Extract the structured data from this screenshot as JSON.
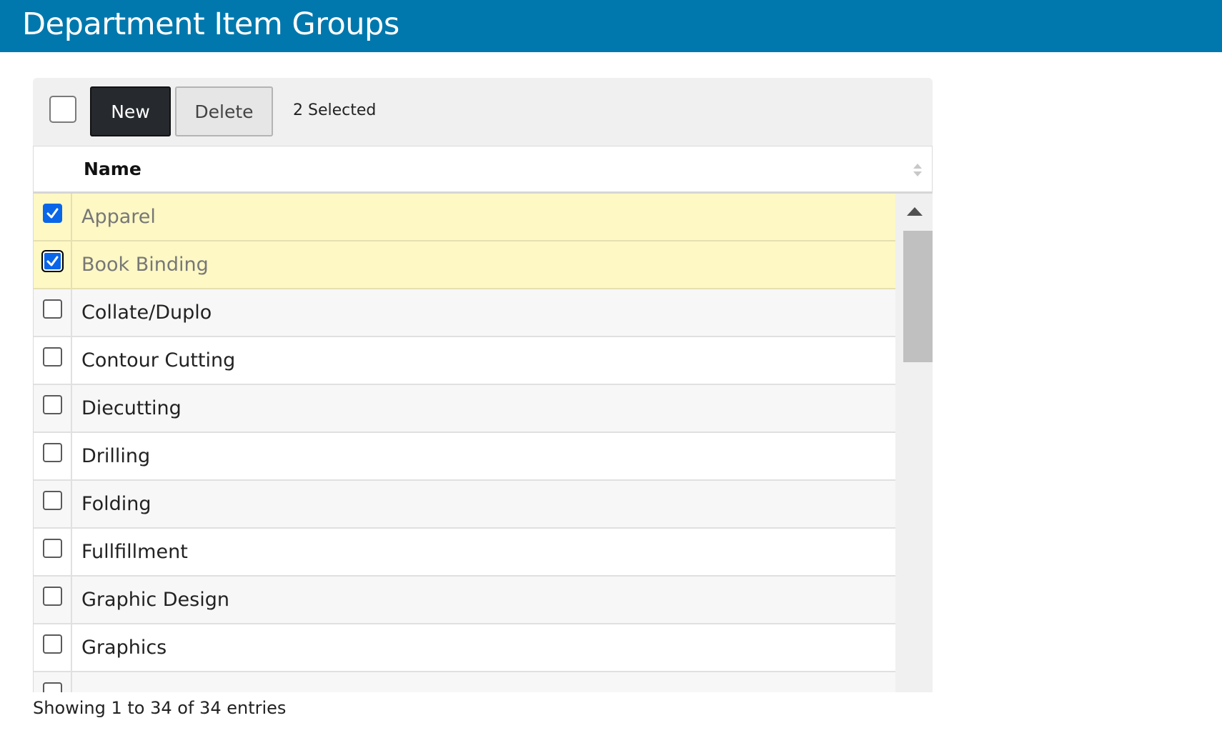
{
  "header": {
    "title": "Department Item Groups"
  },
  "toolbar": {
    "new_label": "New",
    "delete_label": "Delete",
    "selected_text": "2 Selected"
  },
  "table": {
    "column_name": "Name",
    "rows": [
      {
        "name": "Apparel",
        "checked": true,
        "focused": false
      },
      {
        "name": "Book Binding",
        "checked": true,
        "focused": true
      },
      {
        "name": "Collate/Duplo",
        "checked": false,
        "focused": false
      },
      {
        "name": "Contour Cutting",
        "checked": false,
        "focused": false
      },
      {
        "name": "Diecutting",
        "checked": false,
        "focused": false
      },
      {
        "name": "Drilling",
        "checked": false,
        "focused": false
      },
      {
        "name": "Folding",
        "checked": false,
        "focused": false
      },
      {
        "name": "Fullfillment",
        "checked": false,
        "focused": false
      },
      {
        "name": "Graphic Design",
        "checked": false,
        "focused": false
      },
      {
        "name": "Graphics",
        "checked": false,
        "focused": false
      },
      {
        "name": "",
        "checked": false,
        "focused": false
      }
    ]
  },
  "footer": {
    "info": "Showing 1 to 34 of 34 entries"
  },
  "colors": {
    "header_bg": "#0078ad",
    "selected_row": "#fdf8c4",
    "checkbox_checked": "#0a66e8",
    "new_button_bg": "#262a2e"
  },
  "icons": {
    "sort": "sort-icon",
    "check": "checkmark-icon",
    "scroll_up": "triangle-up-icon",
    "scroll_down": "triangle-down-icon"
  }
}
